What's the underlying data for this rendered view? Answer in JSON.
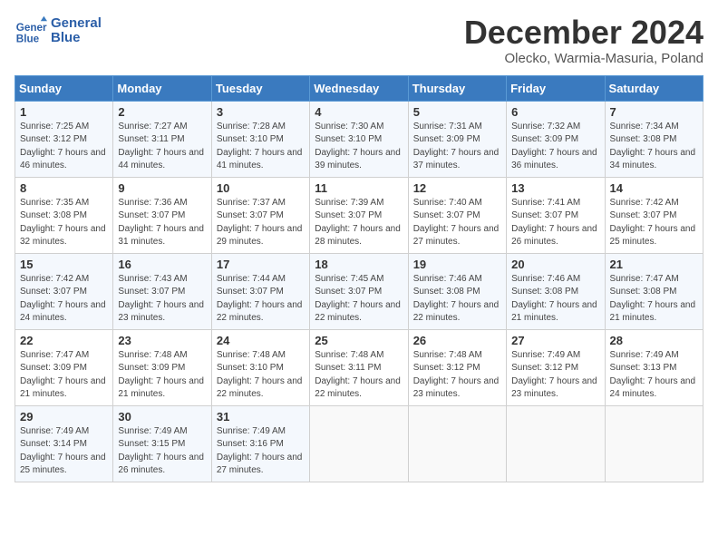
{
  "header": {
    "logo_line1": "General",
    "logo_line2": "Blue",
    "month": "December 2024",
    "location": "Olecko, Warmia-Masuria, Poland"
  },
  "weekdays": [
    "Sunday",
    "Monday",
    "Tuesday",
    "Wednesday",
    "Thursday",
    "Friday",
    "Saturday"
  ],
  "weeks": [
    [
      {
        "day": "1",
        "sunrise": "7:25 AM",
        "sunset": "3:12 PM",
        "daylight": "7 hours and 46 minutes."
      },
      {
        "day": "2",
        "sunrise": "7:27 AM",
        "sunset": "3:11 PM",
        "daylight": "7 hours and 44 minutes."
      },
      {
        "day": "3",
        "sunrise": "7:28 AM",
        "sunset": "3:10 PM",
        "daylight": "7 hours and 41 minutes."
      },
      {
        "day": "4",
        "sunrise": "7:30 AM",
        "sunset": "3:10 PM",
        "daylight": "7 hours and 39 minutes."
      },
      {
        "day": "5",
        "sunrise": "7:31 AM",
        "sunset": "3:09 PM",
        "daylight": "7 hours and 37 minutes."
      },
      {
        "day": "6",
        "sunrise": "7:32 AM",
        "sunset": "3:09 PM",
        "daylight": "7 hours and 36 minutes."
      },
      {
        "day": "7",
        "sunrise": "7:34 AM",
        "sunset": "3:08 PM",
        "daylight": "7 hours and 34 minutes."
      }
    ],
    [
      {
        "day": "8",
        "sunrise": "7:35 AM",
        "sunset": "3:08 PM",
        "daylight": "7 hours and 32 minutes."
      },
      {
        "day": "9",
        "sunrise": "7:36 AM",
        "sunset": "3:07 PM",
        "daylight": "7 hours and 31 minutes."
      },
      {
        "day": "10",
        "sunrise": "7:37 AM",
        "sunset": "3:07 PM",
        "daylight": "7 hours and 29 minutes."
      },
      {
        "day": "11",
        "sunrise": "7:39 AM",
        "sunset": "3:07 PM",
        "daylight": "7 hours and 28 minutes."
      },
      {
        "day": "12",
        "sunrise": "7:40 AM",
        "sunset": "3:07 PM",
        "daylight": "7 hours and 27 minutes."
      },
      {
        "day": "13",
        "sunrise": "7:41 AM",
        "sunset": "3:07 PM",
        "daylight": "7 hours and 26 minutes."
      },
      {
        "day": "14",
        "sunrise": "7:42 AM",
        "sunset": "3:07 PM",
        "daylight": "7 hours and 25 minutes."
      }
    ],
    [
      {
        "day": "15",
        "sunrise": "7:42 AM",
        "sunset": "3:07 PM",
        "daylight": "7 hours and 24 minutes."
      },
      {
        "day": "16",
        "sunrise": "7:43 AM",
        "sunset": "3:07 PM",
        "daylight": "7 hours and 23 minutes."
      },
      {
        "day": "17",
        "sunrise": "7:44 AM",
        "sunset": "3:07 PM",
        "daylight": "7 hours and 22 minutes."
      },
      {
        "day": "18",
        "sunrise": "7:45 AM",
        "sunset": "3:07 PM",
        "daylight": "7 hours and 22 minutes."
      },
      {
        "day": "19",
        "sunrise": "7:46 AM",
        "sunset": "3:08 PM",
        "daylight": "7 hours and 22 minutes."
      },
      {
        "day": "20",
        "sunrise": "7:46 AM",
        "sunset": "3:08 PM",
        "daylight": "7 hours and 21 minutes."
      },
      {
        "day": "21",
        "sunrise": "7:47 AM",
        "sunset": "3:08 PM",
        "daylight": "7 hours and 21 minutes."
      }
    ],
    [
      {
        "day": "22",
        "sunrise": "7:47 AM",
        "sunset": "3:09 PM",
        "daylight": "7 hours and 21 minutes."
      },
      {
        "day": "23",
        "sunrise": "7:48 AM",
        "sunset": "3:09 PM",
        "daylight": "7 hours and 21 minutes."
      },
      {
        "day": "24",
        "sunrise": "7:48 AM",
        "sunset": "3:10 PM",
        "daylight": "7 hours and 22 minutes."
      },
      {
        "day": "25",
        "sunrise": "7:48 AM",
        "sunset": "3:11 PM",
        "daylight": "7 hours and 22 minutes."
      },
      {
        "day": "26",
        "sunrise": "7:48 AM",
        "sunset": "3:12 PM",
        "daylight": "7 hours and 23 minutes."
      },
      {
        "day": "27",
        "sunrise": "7:49 AM",
        "sunset": "3:12 PM",
        "daylight": "7 hours and 23 minutes."
      },
      {
        "day": "28",
        "sunrise": "7:49 AM",
        "sunset": "3:13 PM",
        "daylight": "7 hours and 24 minutes."
      }
    ],
    [
      {
        "day": "29",
        "sunrise": "7:49 AM",
        "sunset": "3:14 PM",
        "daylight": "7 hours and 25 minutes."
      },
      {
        "day": "30",
        "sunrise": "7:49 AM",
        "sunset": "3:15 PM",
        "daylight": "7 hours and 26 minutes."
      },
      {
        "day": "31",
        "sunrise": "7:49 AM",
        "sunset": "3:16 PM",
        "daylight": "7 hours and 27 minutes."
      },
      null,
      null,
      null,
      null
    ]
  ]
}
